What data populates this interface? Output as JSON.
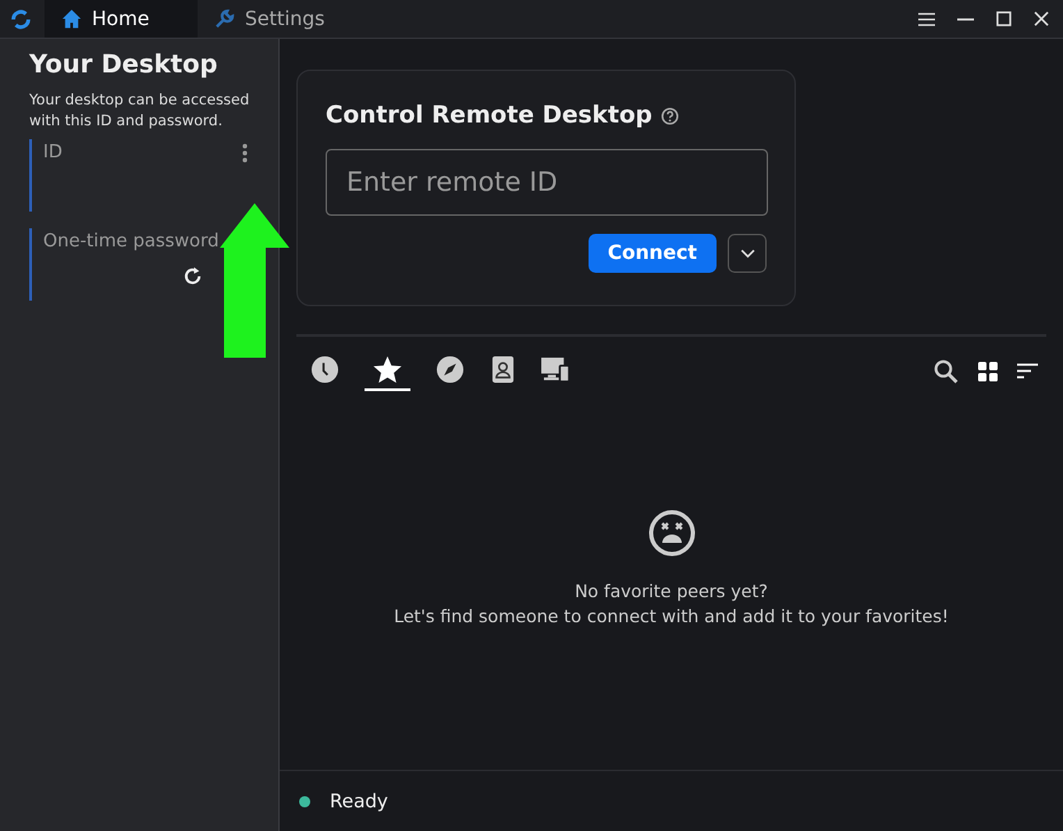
{
  "tabs": [
    {
      "label": "Home",
      "kind": "home",
      "selected": true
    },
    {
      "label": "Settings",
      "kind": "settings",
      "selected": false
    }
  ],
  "sidebar": {
    "title": "Your Desktop",
    "description": "Your desktop can be accessed with this ID and password.",
    "fields": [
      {
        "label": "ID",
        "kind": "id"
      },
      {
        "label": "One-time password",
        "kind": "password"
      }
    ]
  },
  "remote": {
    "title": "Control Remote Desktop",
    "placeholder": "Enter remote ID",
    "button": "Connect"
  },
  "peer_tabs": [
    {
      "kind": "recent",
      "selected": false
    },
    {
      "kind": "favorites",
      "selected": true
    },
    {
      "kind": "discovered",
      "selected": false
    },
    {
      "kind": "address-book",
      "selected": false
    },
    {
      "kind": "group",
      "selected": false
    }
  ],
  "empty": {
    "lines": [
      "No favorite peers yet?",
      "Let's find someone to connect with and add it to your favorites!"
    ]
  },
  "status_bar": {
    "text": "Ready"
  }
}
